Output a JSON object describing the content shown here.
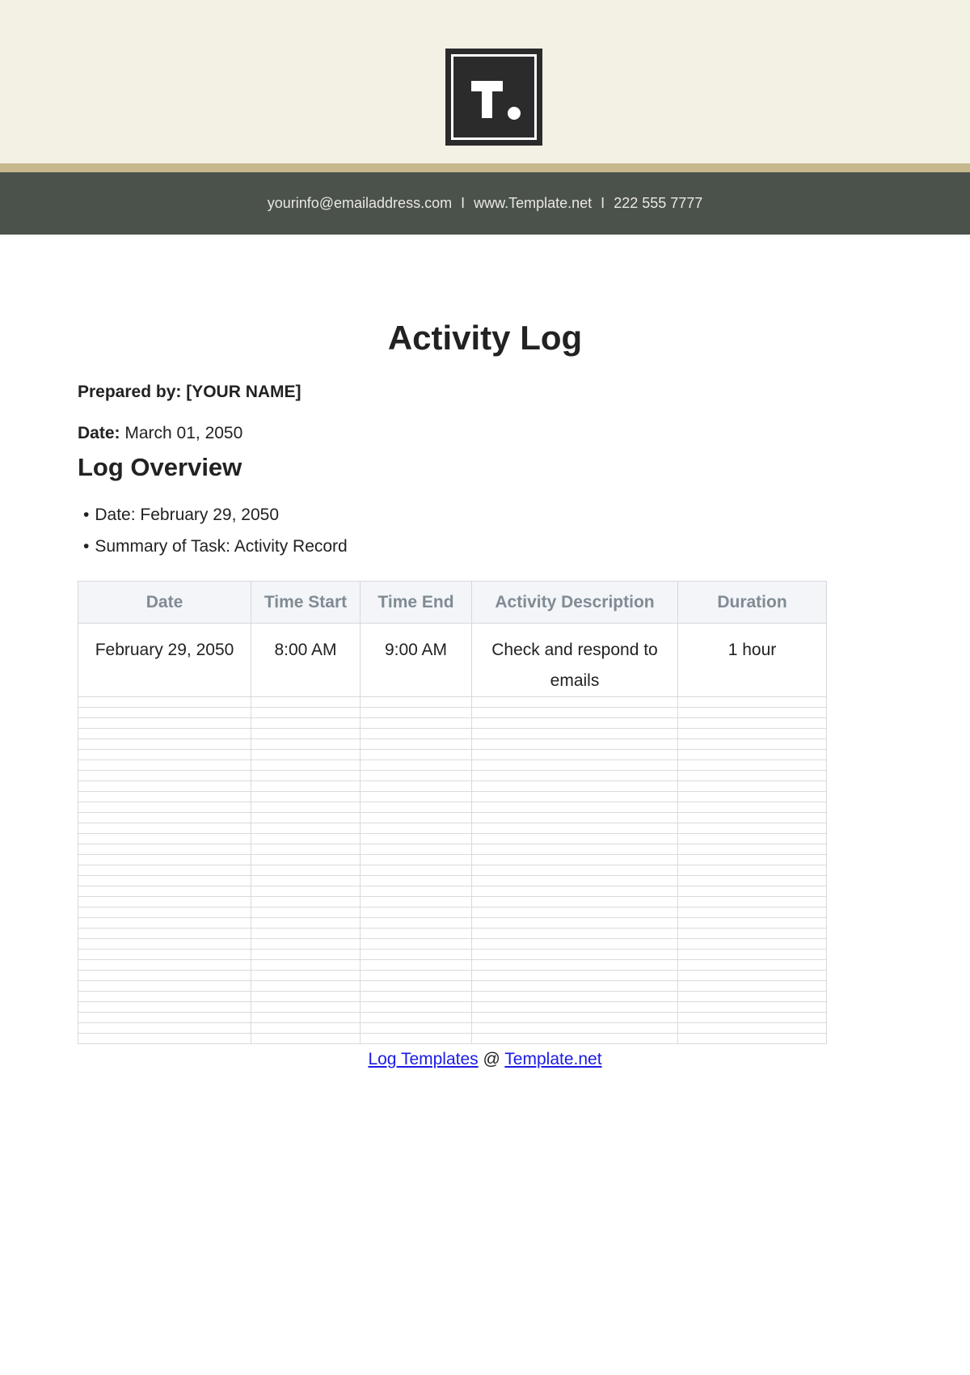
{
  "header": {
    "logo_letter": "T",
    "contact": {
      "email": "yourinfo@emailaddress.com",
      "website": "www.Template.net",
      "phone": "222 555 7777",
      "separator": "I"
    }
  },
  "document": {
    "title": "Activity Log",
    "prepared_by": "Prepared by: [YOUR NAME]",
    "date_label": "Date:",
    "date_value": "March 01, 2050"
  },
  "overview": {
    "heading": "Log Overview",
    "items": [
      "Date: February 29, 2050",
      "Summary of Task: Activity Record"
    ]
  },
  "table": {
    "headers": [
      "Date",
      "Time Start",
      "Time End",
      "Activity Description",
      "Duration"
    ],
    "rows": [
      [
        "February 29, 2050",
        "8:00 AM",
        "9:00 AM",
        "Check and respond to emails",
        "1 hour"
      ]
    ]
  },
  "footer": {
    "link1": "Log Templates",
    "between": "@",
    "link2": "Template.net"
  },
  "colors": {
    "header_bg": "#f3f0e4",
    "gold_band": "#c6b88c",
    "contact_band": "#4b524b",
    "table_header_bg": "#f3f5f8",
    "link": "#1a1ae6"
  }
}
